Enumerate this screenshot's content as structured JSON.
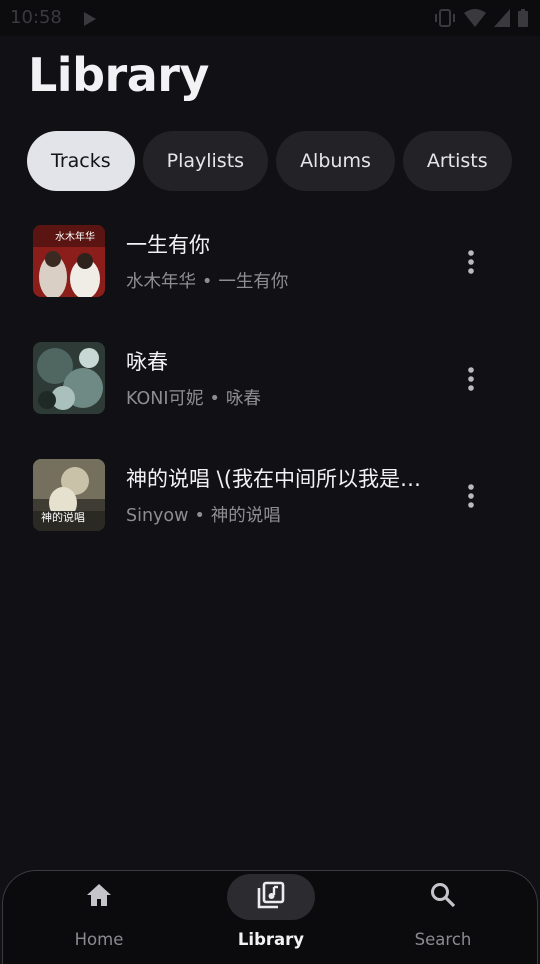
{
  "status_bar": {
    "time": "10:58"
  },
  "page_title": "Library",
  "chips": [
    {
      "label": "Tracks",
      "selected": true
    },
    {
      "label": "Playlists",
      "selected": false
    },
    {
      "label": "Albums",
      "selected": false
    },
    {
      "label": "Artists",
      "selected": false
    }
  ],
  "tracks": [
    {
      "title": "一生有你",
      "artist": "水木年华",
      "album": "一生有你",
      "separator": "•",
      "cover_text": "水木年华"
    },
    {
      "title": "咏春",
      "artist": "KONI可妮",
      "album": "咏春",
      "separator": "•"
    },
    {
      "title": "神的说唱 \\(我在中间所以我是…",
      "artist": "Sinyow",
      "album": "神的说唱",
      "separator": "•",
      "cover_text": "神的说唱"
    }
  ],
  "nav": {
    "items": [
      {
        "label": "Home",
        "icon": "home-icon",
        "active": false
      },
      {
        "label": "Library",
        "icon": "library-music-icon",
        "active": true
      },
      {
        "label": "Search",
        "icon": "search-icon",
        "active": false
      }
    ]
  },
  "colors": {
    "background": "#111115",
    "chip_active_bg": "#e3e3ea",
    "chip_bg": "#232327",
    "secondary_text": "#8d8d93",
    "nav_pill_active": "#2b2b30"
  }
}
